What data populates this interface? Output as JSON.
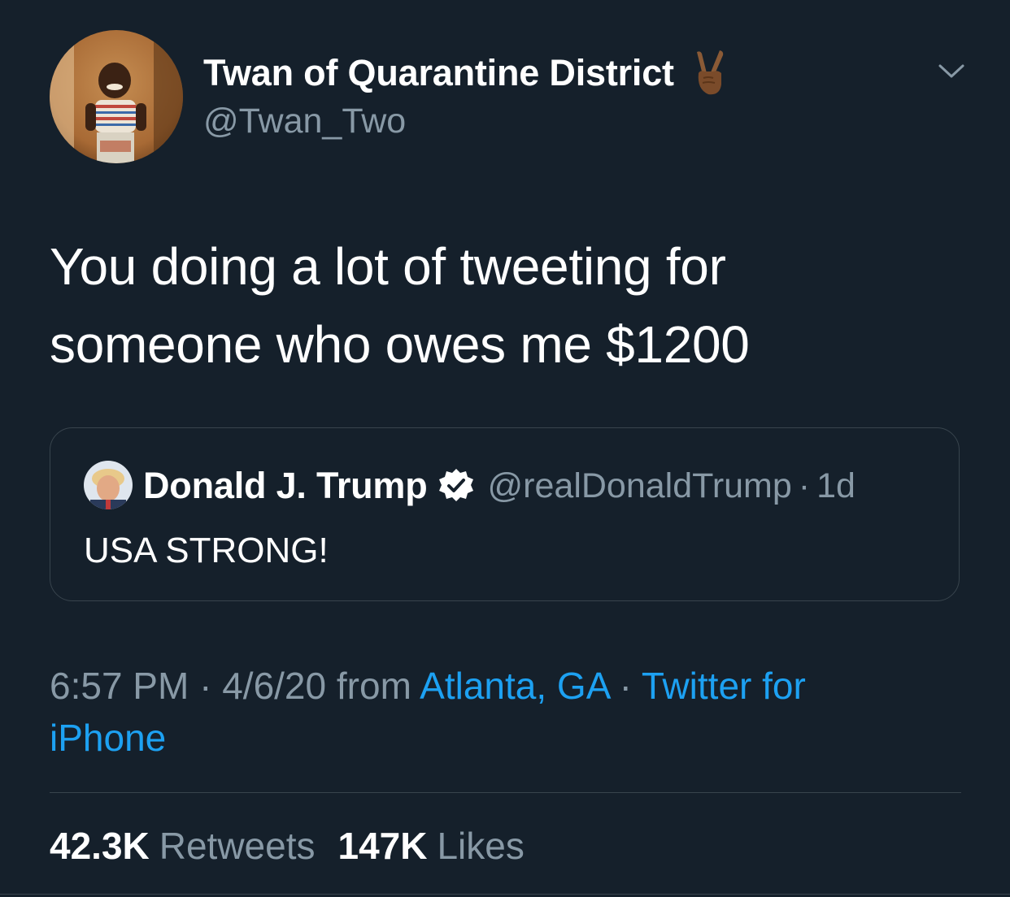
{
  "author": {
    "display_name": "Twan of Quarantine District",
    "handle": "@Twan_Two",
    "emoji": "victory-hand-dark-skin-tone",
    "avatar": "child-photo-avatar"
  },
  "tweet": {
    "text_line1": "You doing a lot of tweeting for",
    "text_line2": "someone who owes me $1200"
  },
  "quoted_tweet": {
    "display_name": "Donald J. Trump",
    "verified": true,
    "handle": "@realDonaldTrump",
    "separator": "·",
    "time": "1d",
    "text": "USA STRONG!"
  },
  "meta": {
    "time": "6:57 PM",
    "sep1": "·",
    "date": "4/6/20",
    "from_label": "from",
    "location": "Atlanta, GA",
    "sep2": "·",
    "source_line1": "Twitter for",
    "source_line2": "iPhone"
  },
  "stats": {
    "retweets_count": "42.3K",
    "retweets_label": "Retweets",
    "likes_count": "147K",
    "likes_label": "Likes"
  },
  "colors": {
    "background": "#15202b",
    "secondary_text": "#8899a6",
    "link": "#1da1f2",
    "border": "#38444d",
    "verified": "#ffffff"
  },
  "icons": {
    "more": "chevron-down-icon",
    "verified": "verified-badge-icon"
  }
}
